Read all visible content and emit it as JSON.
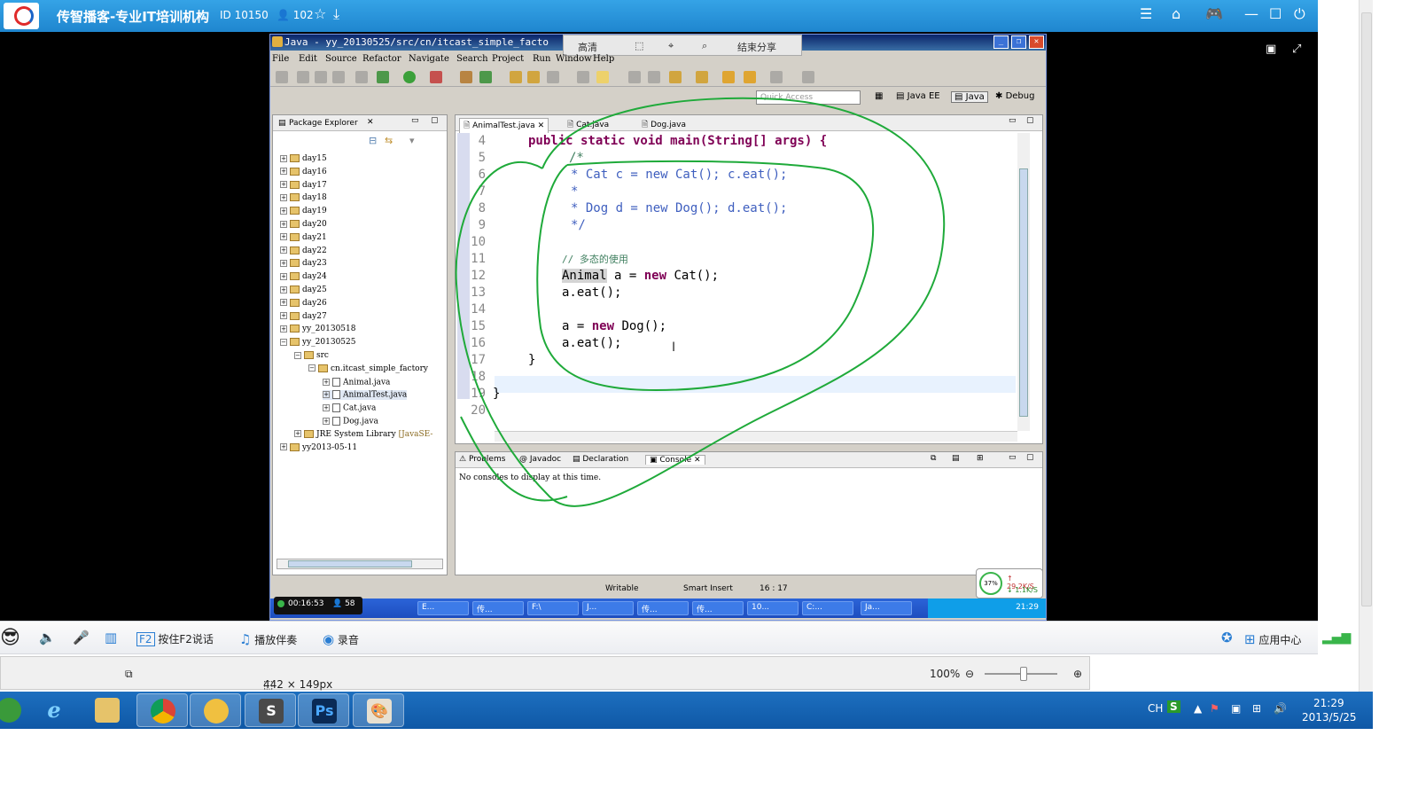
{
  "yy_top": {
    "title": "传智播客-专业IT培训机构",
    "channel_id": "ID 10150",
    "online_count": "102"
  },
  "eclipse": {
    "window_title": "Java - yy_20130525/src/cn/itcast_simple_facto",
    "share_bar": {
      "quality": "高清",
      "end_share": "结束分享"
    },
    "menu": [
      "File",
      "Edit",
      "Source",
      "Refactor",
      "Navigate",
      "Search",
      "Project",
      "Run",
      "Window",
      "Help"
    ],
    "quick_access_placeholder": "Quick Access",
    "perspectives": [
      "Java EE",
      "Java",
      "Debug"
    ],
    "package_explorer": {
      "tab_label": "Package Explorer",
      "days": [
        "day15",
        "day16",
        "day17",
        "day18",
        "day19",
        "day20",
        "day21",
        "day22",
        "day23",
        "day24",
        "day25",
        "day26",
        "day27"
      ],
      "project_a": "yy_20130518",
      "project_b": "yy_20130525",
      "src": "src",
      "package": "cn.itcast_simple_factory",
      "files": [
        "Animal.java",
        "AnimalTest.java",
        "Cat.java",
        "Dog.java"
      ],
      "jre": "JRE System Library",
      "jre_tag": "[JavaSE-",
      "project_c": "yy2013-05-11"
    },
    "editor_tabs": [
      "AnimalTest.java",
      "Cat.java",
      "Dog.java"
    ],
    "code": {
      "l4": "public static void main(String[] args) {",
      "l5": "/*",
      "l6": "* Cat c = new Cat(); c.eat();",
      "l7": "*",
      "l8": "* Dog d = new Dog(); d.eat();",
      "l9": "*/",
      "l11": "// 多态的使用",
      "l12_type": "Animal",
      "l12_rest": " a = ",
      "l12_new": "new",
      "l12_end": " Cat();",
      "l13": "a.eat();",
      "l15_a": "a = ",
      "l15_new": "new",
      "l15_end": " Dog();",
      "l16": "a.eat();",
      "l17": "}",
      "l19": "}"
    },
    "line_numbers": [
      "4",
      "5",
      "6",
      "7",
      "8",
      "9",
      "10",
      "11",
      "12",
      "13",
      "14",
      "15",
      "16",
      "17",
      "18",
      "19",
      "20"
    ],
    "console_tabs": [
      "Problems",
      "Javadoc",
      "Declaration",
      "Console"
    ],
    "console_message": "No consoles to display at this time.",
    "status": {
      "writable": "Writable",
      "insert_mode": "Smart Insert",
      "position": "16 : 17"
    },
    "net_meter": {
      "cpu": "37%",
      "up": "29.2K/S",
      "down": "1.1K/S"
    },
    "recording_time": "00:16:53",
    "recording_count": "58",
    "inner_taskbar": [
      "E...",
      "传...",
      "F:\\",
      "J...",
      "传...",
      "传...",
      "10...",
      "C:...",
      "Ja..."
    ],
    "inner_clock": "21:29"
  },
  "yy_bottom": {
    "f2_talk": "按住F2说话",
    "play_accompaniment": "播放伴奏",
    "record": "录音",
    "app_center": "应用中心"
  },
  "viewer": {
    "dimensions": "442 × 149px",
    "zoom": "100%"
  },
  "w7_tray": {
    "lang": "CH",
    "time": "21:29",
    "date": "2013/5/25"
  },
  "colors": {
    "yy_blue": "#1f86cf",
    "keyword": "#7f0055",
    "annotation_green": "#1faa3a"
  }
}
